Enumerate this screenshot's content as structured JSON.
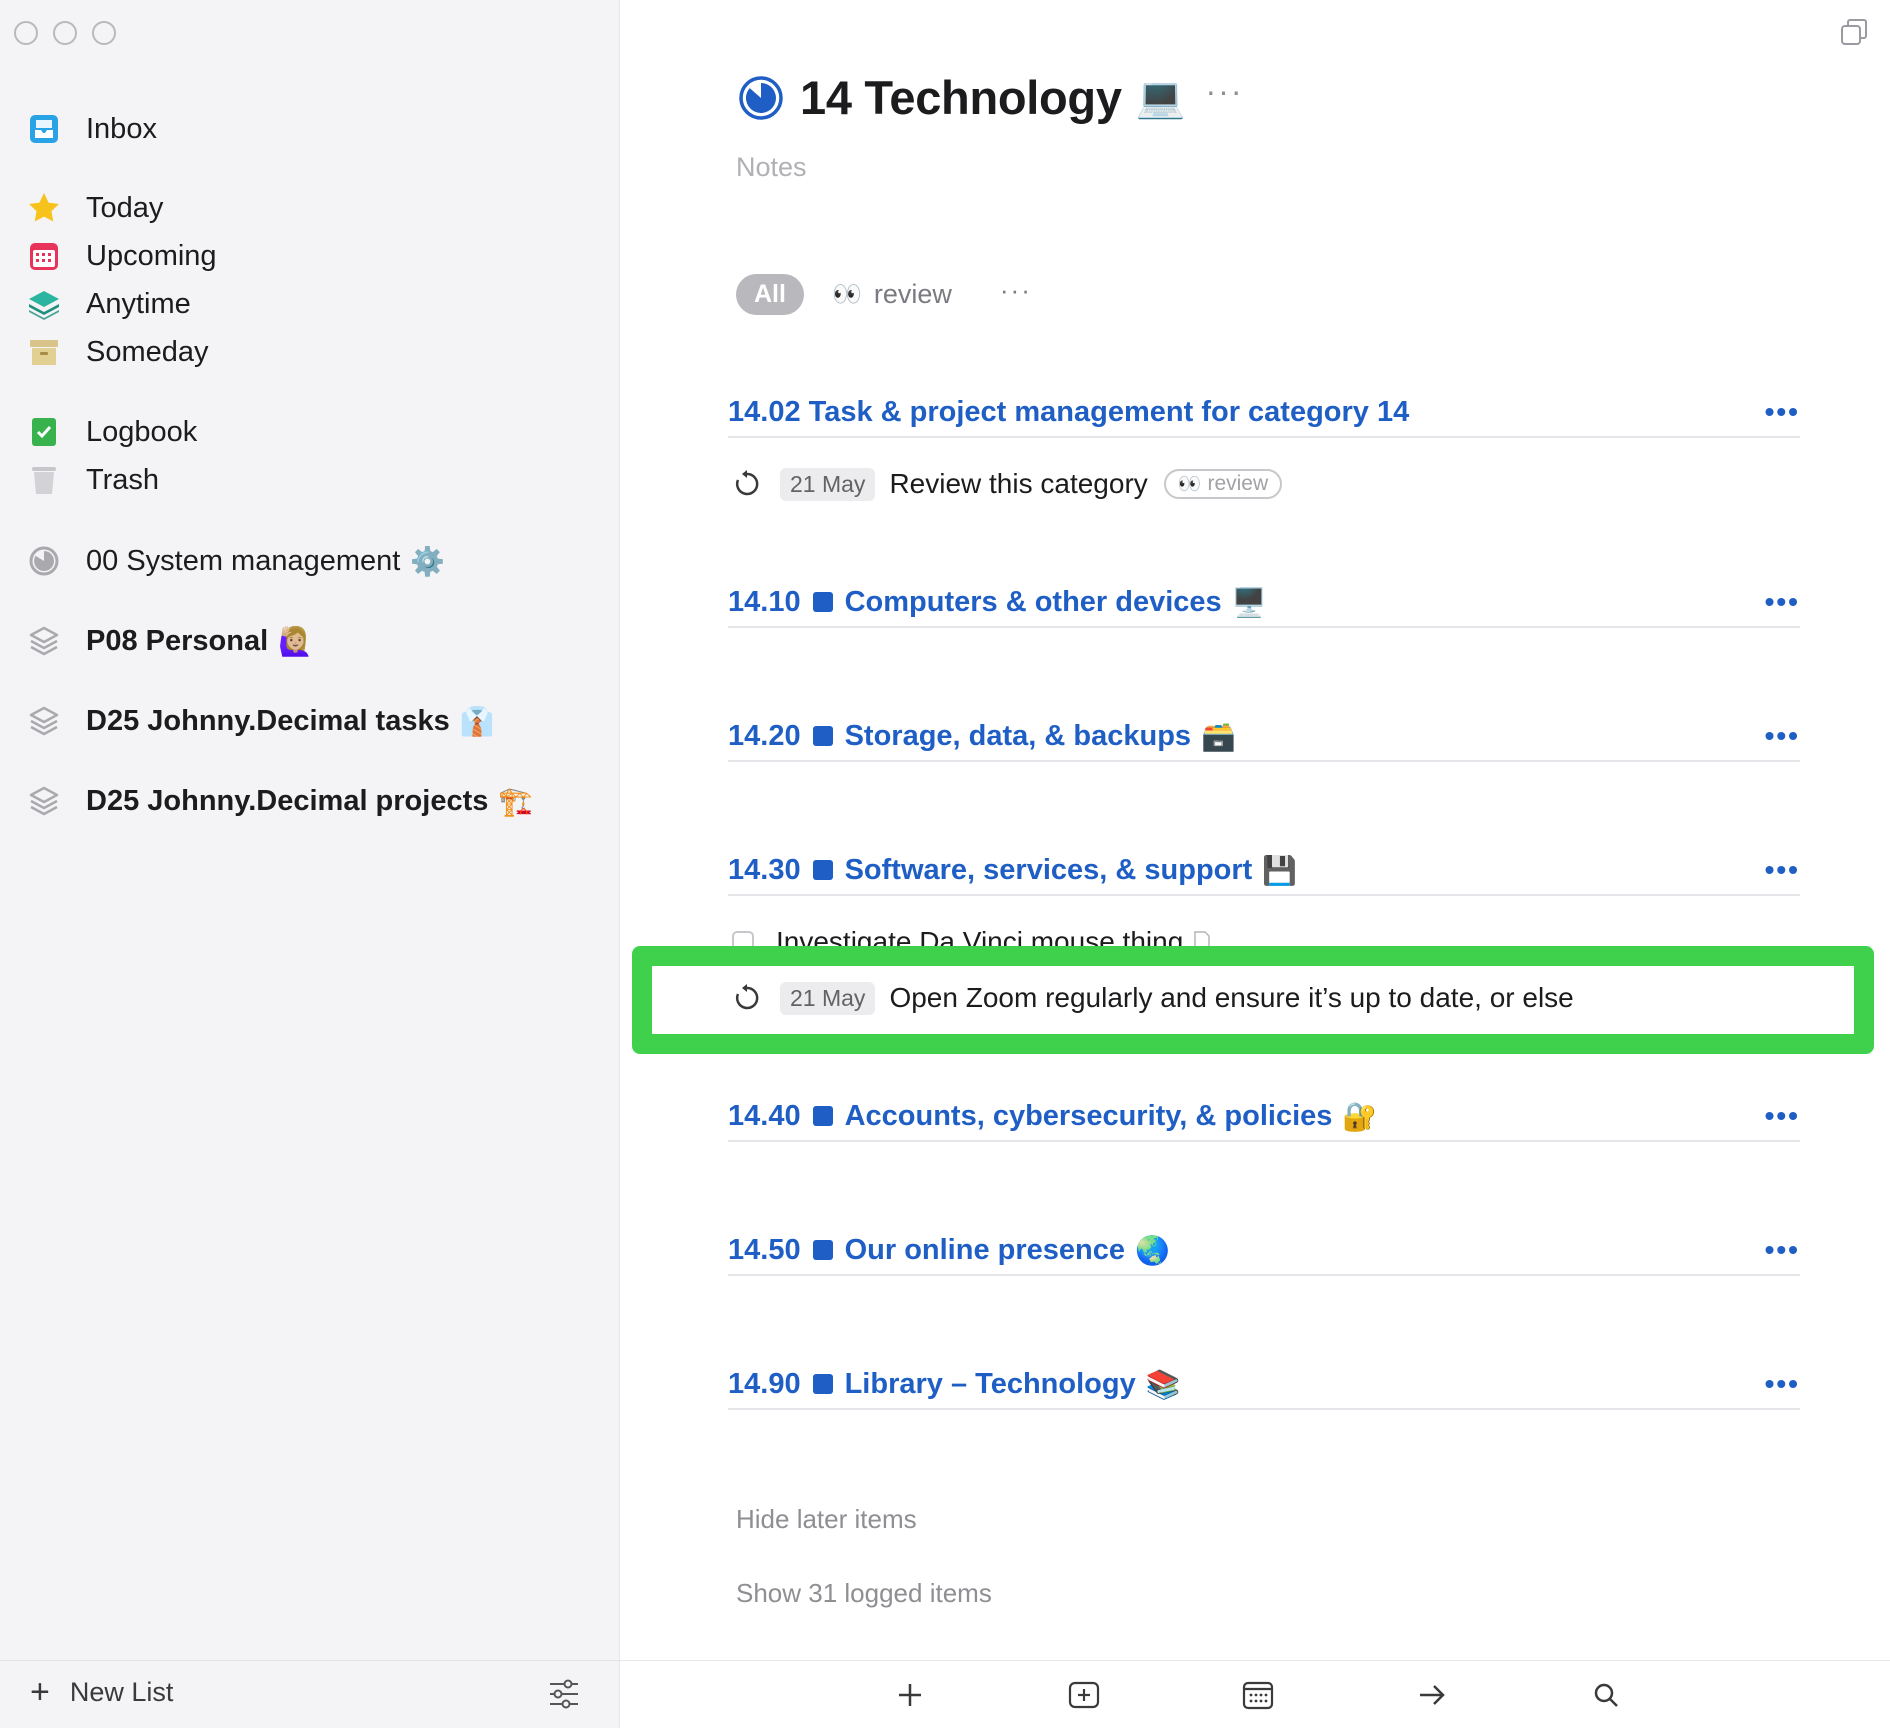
{
  "sidebar": {
    "nav": [
      {
        "label": "Inbox",
        "icon": "inbox-icon"
      },
      {
        "label": "Today",
        "icon": "star-icon"
      },
      {
        "label": "Upcoming",
        "icon": "calendar-icon"
      },
      {
        "label": "Anytime",
        "icon": "layers-icon"
      },
      {
        "label": "Someday",
        "icon": "archive-box-icon"
      },
      {
        "label": "Logbook",
        "icon": "logbook-icon"
      },
      {
        "label": "Trash",
        "icon": "trash-icon"
      }
    ],
    "areas": [
      {
        "label": "00 System management",
        "emoji": "⚙️"
      },
      {
        "label": "P08 Personal",
        "emoji": "🙋🏼‍♀️"
      },
      {
        "label": "D25 Johnny.Decimal tasks",
        "emoji": "👔"
      },
      {
        "label": "D25 Johnny.Decimal projects",
        "emoji": "🏗️"
      }
    ],
    "new_list": "New List"
  },
  "main": {
    "title": "14 Technology",
    "title_emoji": "💻",
    "title_more": "···",
    "notes_placeholder": "Notes",
    "filter": {
      "all": "All",
      "review_eyes": "👀",
      "review": "review",
      "more": "···"
    },
    "headings": [
      {
        "label": "14.02 Task & project management for category 14",
        "emoji": "",
        "square": false
      },
      {
        "label": "14.10",
        "title": "Computers & other devices",
        "emoji": "🖥️",
        "square": true
      },
      {
        "label": "14.20",
        "title": "Storage, data, & backups",
        "emoji": "🗃️",
        "square": true
      },
      {
        "label": "14.30",
        "title": "Software, services, & support",
        "emoji": "💾",
        "square": true
      },
      {
        "label": "14.40",
        "title": "Accounts, cybersecurity, & policies",
        "emoji": "🔐",
        "square": true
      },
      {
        "label": "14.50",
        "title": "Our online presence",
        "emoji": "🌏",
        "square": true
      },
      {
        "label": "14.90",
        "title": "Library – Technology",
        "emoji": "📚",
        "square": true
      }
    ],
    "heading_more": "•••",
    "tasks": {
      "review": {
        "date": "21 May",
        "title": "Review this category",
        "tag_eyes": "👀",
        "tag": "review"
      },
      "davinci": {
        "title": "Investigate Da Vinci mouse thing"
      },
      "zoom": {
        "date": "21 May",
        "title": "Open Zoom regularly and ensure it’s up to date, or else"
      }
    },
    "hide_later": "Hide later items",
    "show_logged": "Show 31 logged items"
  },
  "colors": {
    "accent": "#1f5fc5",
    "highlight": "#3fd14b",
    "sidebar_bg": "#f4f4f6"
  }
}
